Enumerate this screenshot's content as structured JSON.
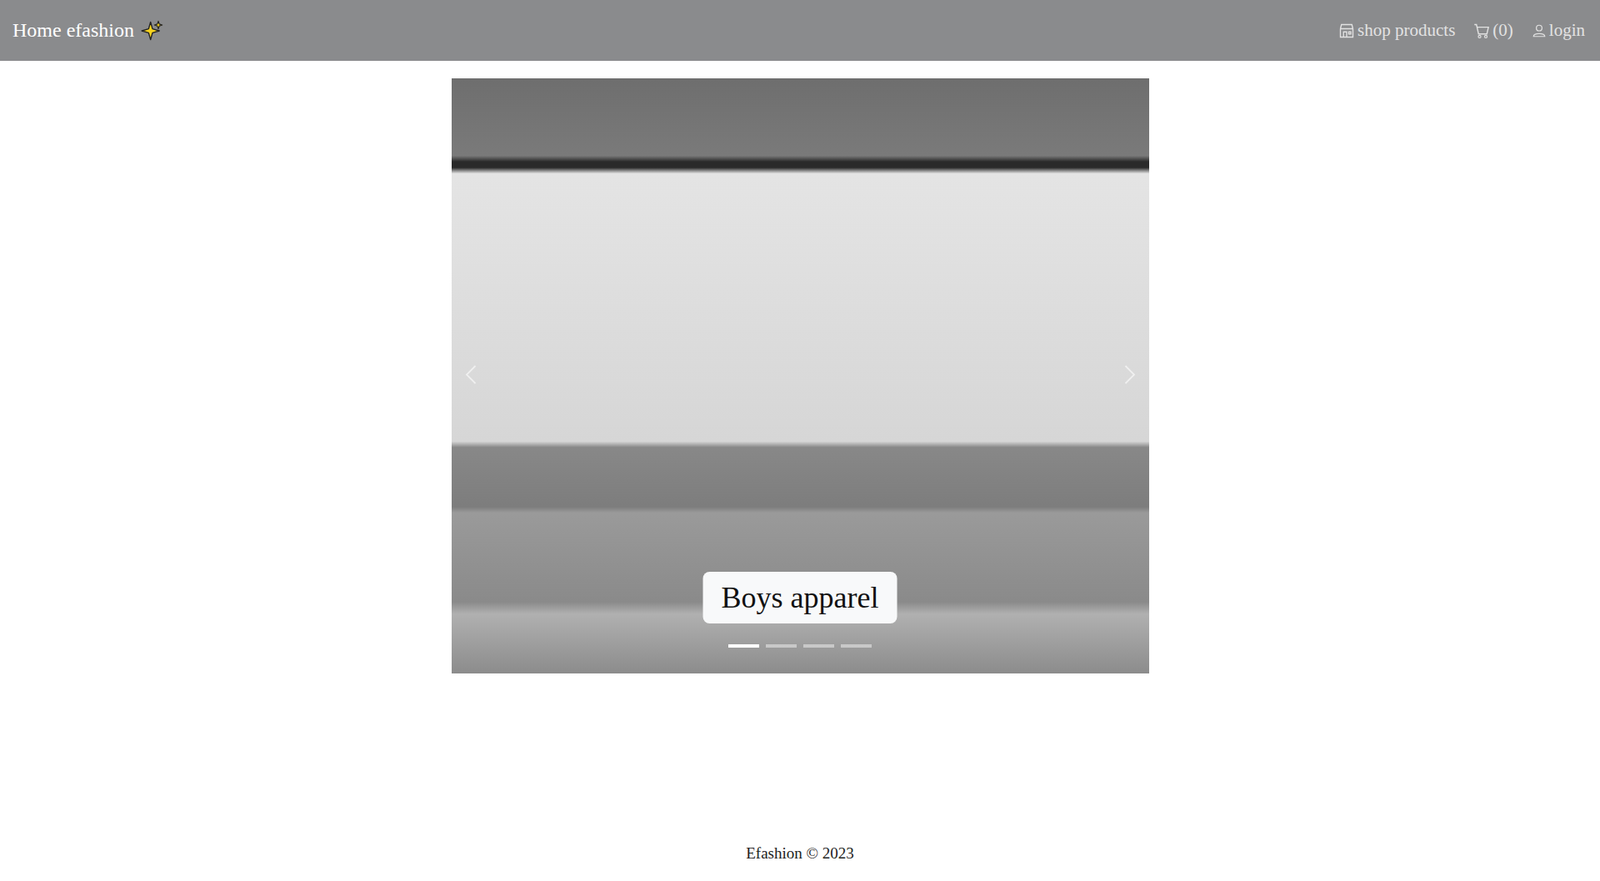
{
  "navbar": {
    "brand": "Home efashion",
    "links": [
      {
        "label": "shop products",
        "kind": "shop"
      },
      {
        "label": "(0)",
        "kind": "cart"
      },
      {
        "label": "login",
        "kind": "user"
      }
    ]
  },
  "carousel": {
    "slides": [
      {
        "caption": "Boys apparel",
        "selected": true
      },
      {
        "caption": "",
        "selected": false
      },
      {
        "caption": "",
        "selected": false
      },
      {
        "caption": "",
        "selected": false
      }
    ]
  },
  "footer": {
    "text": "Efashion © 2023"
  }
}
